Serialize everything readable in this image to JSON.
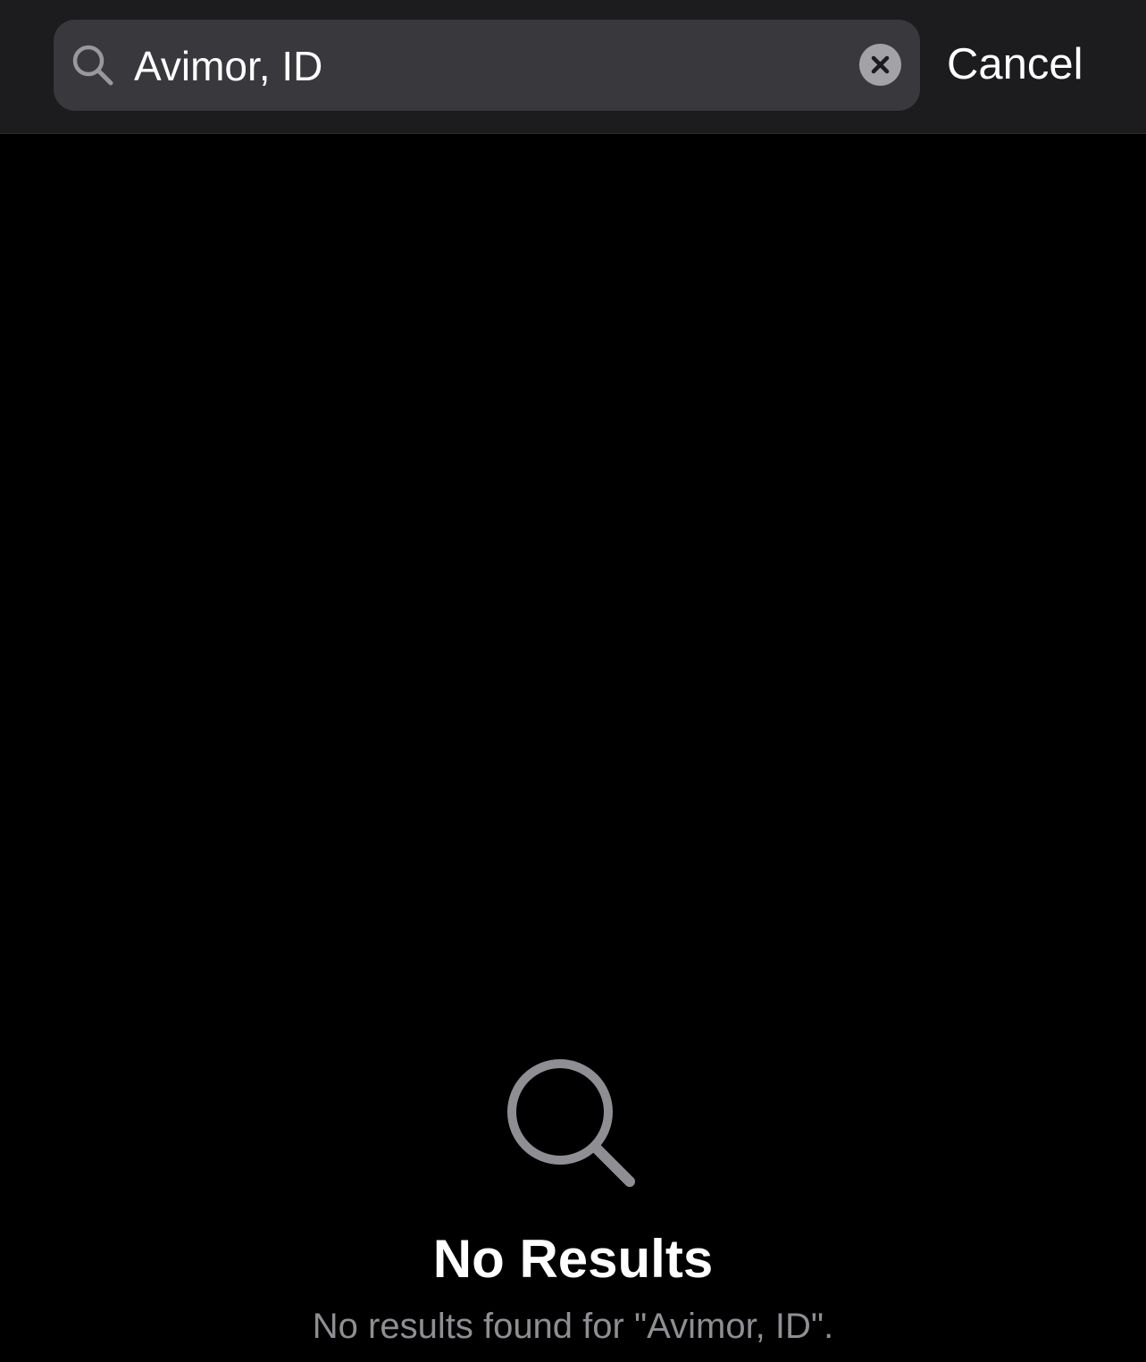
{
  "search": {
    "query": "Avimor, ID",
    "icon": "magnifying-glass",
    "clear_icon": "xmark-circle-fill"
  },
  "header": {
    "cancel_label": "Cancel"
  },
  "empty_state": {
    "icon": "magnifying-glass",
    "title": "No Results",
    "message": "No results found for \"Avimor, ID\"."
  },
  "colors": {
    "background": "#000000",
    "header_background": "#1c1c1e",
    "search_field": "#39393d",
    "secondary_text": "#8e8e93",
    "primary_text": "#ffffff"
  }
}
